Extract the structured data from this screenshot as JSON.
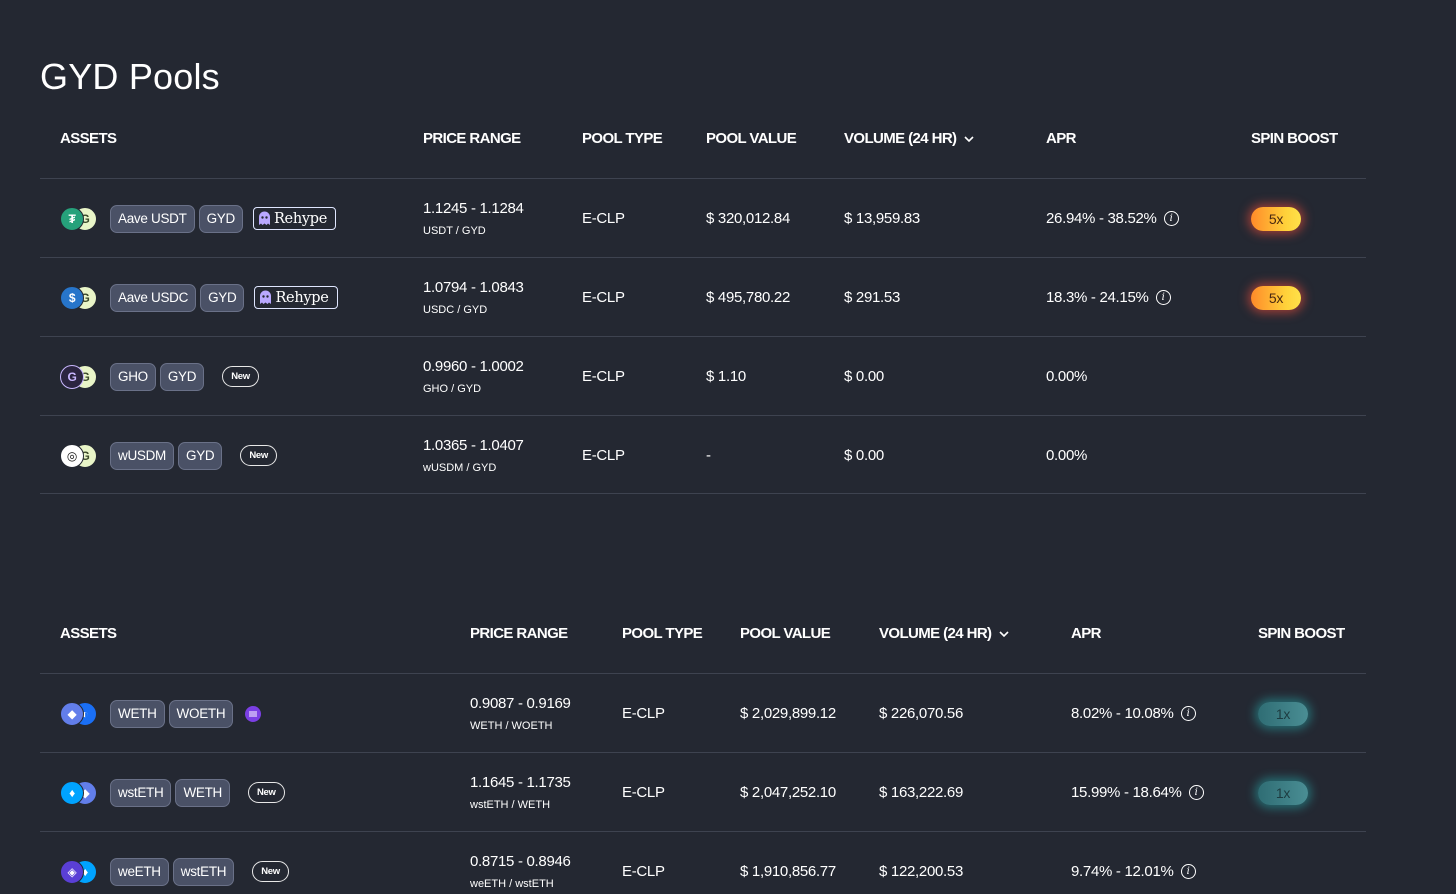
{
  "page": {
    "title": "GYD Pools"
  },
  "colors": {
    "background": "#242832",
    "chip": "#4a5166",
    "boost_hot": "#ffd23a",
    "boost_cool": "#4a8e94",
    "divider": "#3e4350"
  },
  "table1": {
    "headers": {
      "assets": "ASSETS",
      "price_range": "PRICE RANGE",
      "pool_type": "POOL TYPE",
      "pool_value": "POOL VALUE",
      "volume": "VOLUME (24 HR)",
      "apr": "APR",
      "spin_boost": "SPIN BOOST"
    },
    "rows": [
      {
        "icons": [
          "tether-icon",
          "gyd-icon"
        ],
        "tokens": [
          "Aave USDT",
          "GYD"
        ],
        "tag": "Rehype",
        "price_range": "1.1245 - 1.1284",
        "pair": "USDT / GYD",
        "pool_type": "E-CLP",
        "pool_value": "$ 320,012.84",
        "volume": "$ 13,959.83",
        "apr": "26.94% - 38.52%",
        "boost": "5x"
      },
      {
        "icons": [
          "usdc-icon",
          "gyd-icon"
        ],
        "tokens": [
          "Aave USDC",
          "GYD"
        ],
        "tag": "Rehype",
        "price_range": "1.0794 - 1.0843",
        "pair": "USDC / GYD",
        "pool_type": "E-CLP",
        "pool_value": "$ 495,780.22",
        "volume": "$ 291.53",
        "apr": "18.3% - 24.15%",
        "boost": "5x"
      },
      {
        "icons": [
          "gho-icon",
          "gyd-icon"
        ],
        "tokens": [
          "GHO",
          "GYD"
        ],
        "tag": "New",
        "price_range": "0.9960 - 1.0002",
        "pair": "GHO / GYD",
        "pool_type": "E-CLP",
        "pool_value": "$ 1.10",
        "volume": "$ 0.00",
        "apr": "0.00%"
      },
      {
        "icons": [
          "wusdm-icon",
          "gyd-icon"
        ],
        "tokens": [
          "wUSDM",
          "GYD"
        ],
        "tag": "New",
        "price_range": "1.0365 - 1.0407",
        "pair": "wUSDM / GYD",
        "pool_type": "E-CLP",
        "pool_value": "-",
        "volume": "$ 0.00",
        "apr": "0.00%"
      }
    ]
  },
  "table2": {
    "headers": {
      "assets": "ASSETS",
      "price_range": "PRICE RANGE",
      "pool_type": "POOL TYPE",
      "pool_value": "POOL VALUE",
      "volume": "VOLUME (24 HR)",
      "apr": "APR",
      "spin_boost": "SPIN BOOST"
    },
    "rows": [
      {
        "icons": [
          "eth-icon",
          "woeth-icon"
        ],
        "tokens": [
          "WETH",
          "WOETH"
        ],
        "tag": "origin-icon",
        "price_range": "0.9087 - 0.9169",
        "pair": "WETH / WOETH",
        "pool_type": "E-CLP",
        "pool_value": "$ 2,029,899.12",
        "volume": "$ 226,070.56",
        "apr": "8.02% - 10.08%",
        "boost": "1x"
      },
      {
        "icons": [
          "steth-icon",
          "eth-icon"
        ],
        "tokens": [
          "wstETH",
          "WETH"
        ],
        "tag": "New",
        "price_range": "1.1645 - 1.1735",
        "pair": "wstETH / WETH",
        "pool_type": "E-CLP",
        "pool_value": "$ 2,047,252.10",
        "volume": "$ 163,222.69",
        "apr": "15.99% - 18.64%",
        "boost": "1x"
      },
      {
        "icons": [
          "weeth-icon",
          "steth-icon"
        ],
        "tokens": [
          "weETH",
          "wstETH"
        ],
        "tag": "New",
        "price_range": "0.8715 - 0.8946",
        "pair": "weETH / wstETH",
        "pool_type": "E-CLP",
        "pool_value": "$ 1,910,856.77",
        "volume": "$ 122,200.53",
        "apr": "9.74% - 12.01%"
      }
    ]
  }
}
